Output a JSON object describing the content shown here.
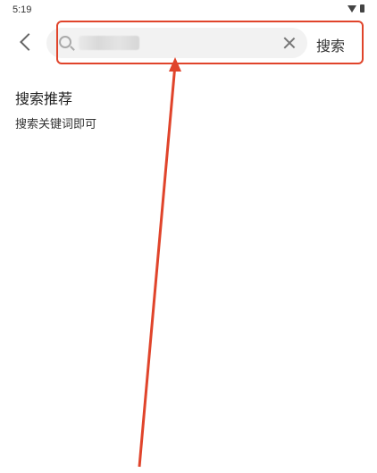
{
  "status_bar": {
    "time": "5:19"
  },
  "header": {
    "search": {
      "value": "",
      "placeholder": ""
    },
    "search_button_label": "搜索"
  },
  "content": {
    "section_title": "搜索推荐",
    "section_hint": "搜索关键词即可"
  },
  "colors": {
    "annotation": "#e0442b",
    "search_bg": "#f2f2f2"
  },
  "icons": {
    "back": "chevron-left-icon",
    "search": "search-icon",
    "clear": "close-icon"
  }
}
